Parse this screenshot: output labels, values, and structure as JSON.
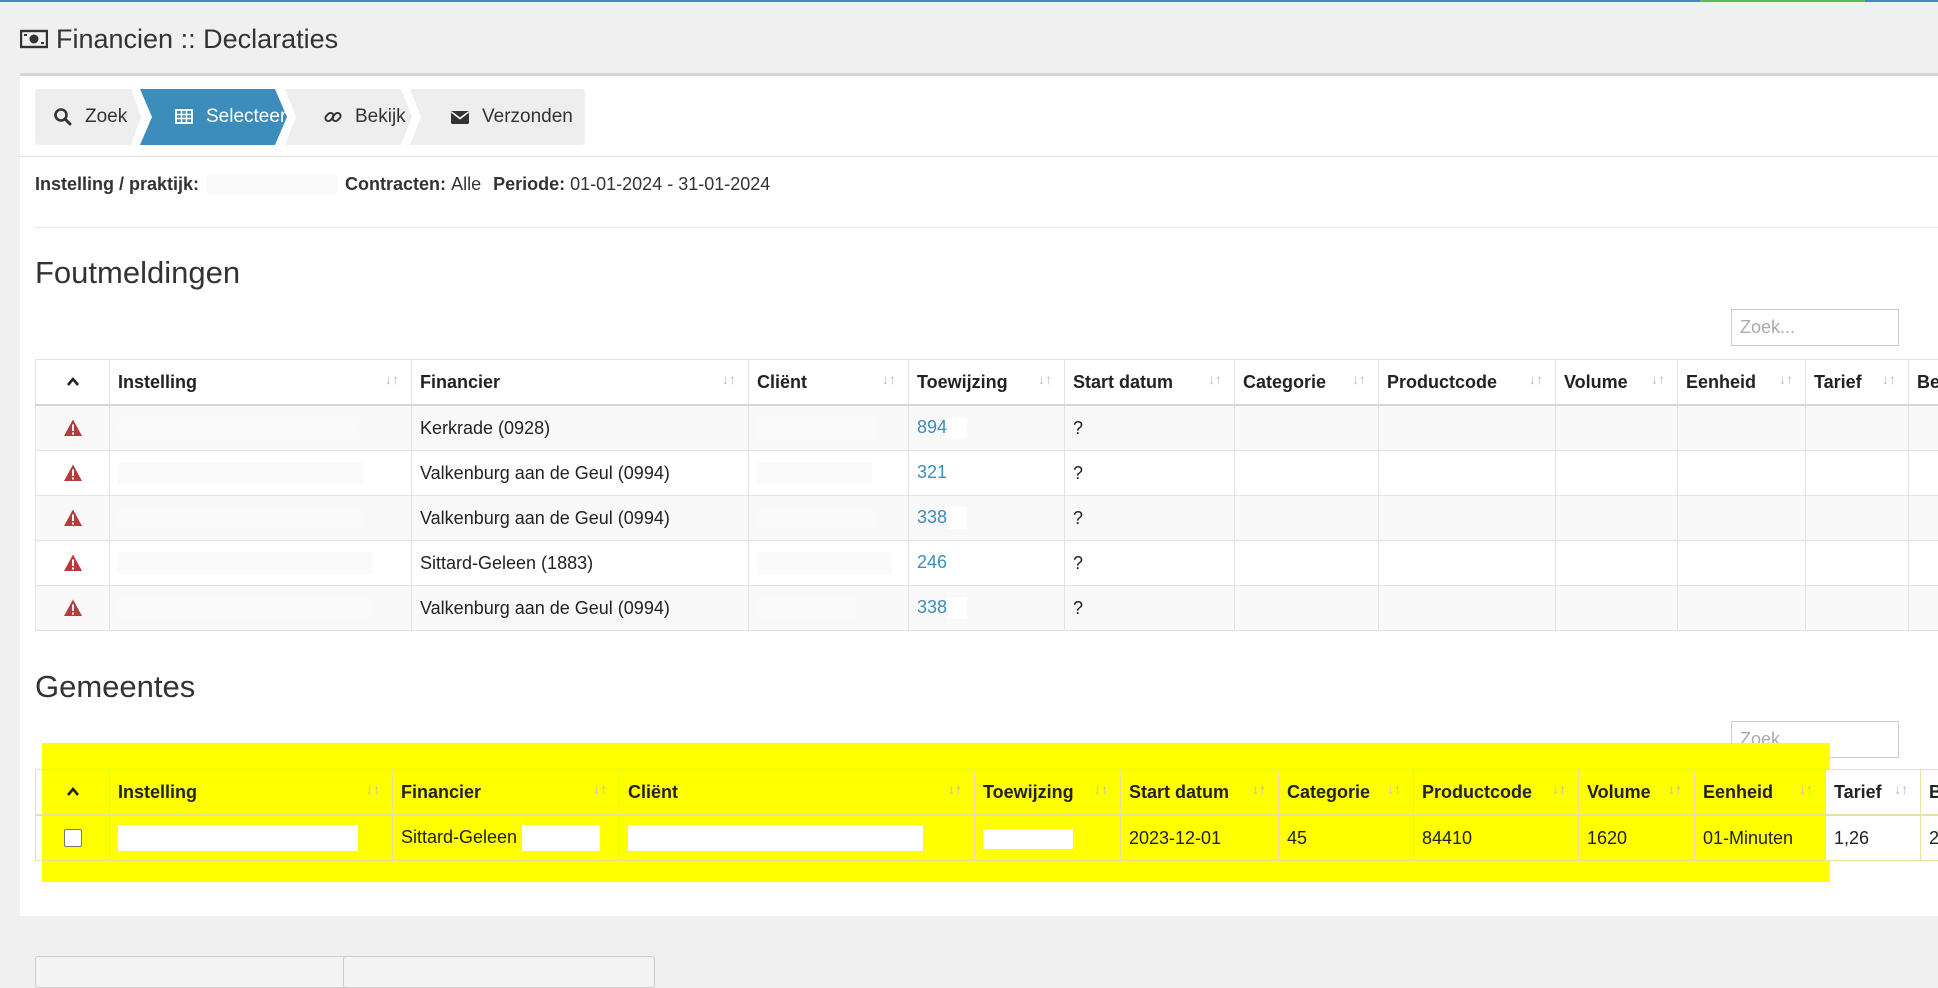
{
  "page": {
    "title": "Financien :: Declaraties"
  },
  "steps": [
    {
      "label": "Zoek",
      "icon": "search-icon",
      "active": false
    },
    {
      "label": "Selecteer",
      "icon": "table-icon",
      "active": true
    },
    {
      "label": "Bekijk",
      "icon": "link-icon",
      "active": false
    },
    {
      "label": "Verzonden",
      "icon": "envelope-icon",
      "active": false
    }
  ],
  "meta": {
    "instelling_label": "Instelling / praktijk:",
    "contracten_label": "Contracten:",
    "contracten_value": "Alle",
    "periode_label": "Periode:",
    "periode_value": "01-01-2024 - 31-01-2024"
  },
  "foutmeldingen": {
    "title": "Foutmeldingen",
    "search_placeholder": "Zoek...",
    "columns": [
      "Instelling",
      "Financier",
      "Cliënt",
      "Toewijzing",
      "Start datum",
      "Categorie",
      "Productcode",
      "Volume",
      "Eenheid",
      "Tarief",
      "Be"
    ],
    "rows": [
      {
        "financier": "Kerkrade (0928)",
        "toewijzing": "894",
        "start": "?"
      },
      {
        "financier": "Valkenburg aan de Geul (0994)",
        "toewijzing": "321",
        "start": "?"
      },
      {
        "financier": "Valkenburg aan de Geul (0994)",
        "toewijzing": "338",
        "start": "?"
      },
      {
        "financier": "Sittard-Geleen (1883)",
        "toewijzing": "246",
        "start": "?"
      },
      {
        "financier": "Valkenburg aan de Geul (0994)",
        "toewijzing": "338",
        "start": "?"
      }
    ]
  },
  "gemeentes": {
    "title": "Gemeentes",
    "search_placeholder": "Zoek...",
    "columns": [
      "Instelling",
      "Financier",
      "Cliënt",
      "Toewijzing",
      "Start datum",
      "Categorie",
      "Productcode",
      "Volume",
      "Eenheid",
      "Tarief",
      "B"
    ],
    "rows": [
      {
        "financier": "Sittard-Geleen",
        "start": "2023-12-01",
        "categorie": "45",
        "productcode": "84410",
        "volume": "1620",
        "eenheid": "01-Minuten",
        "tarief": "1,26",
        "b": "2"
      }
    ]
  },
  "colors": {
    "accent": "#3c8dbc",
    "highlight": "#ffff00",
    "warning": "#b83b3b"
  }
}
